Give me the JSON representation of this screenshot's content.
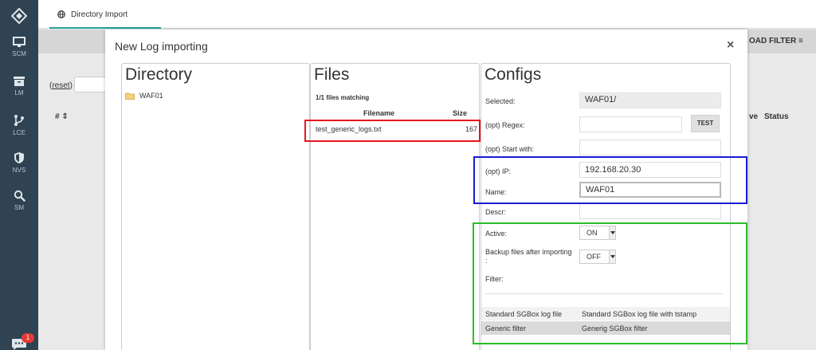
{
  "sidebar": {
    "items": [
      {
        "label": "SCM",
        "icon": "monitor-icon"
      },
      {
        "label": "LM",
        "icon": "archive-icon"
      },
      {
        "label": "LCE",
        "icon": "branch-icon"
      },
      {
        "label": "NVS",
        "icon": "shield-icon"
      },
      {
        "label": "SM",
        "icon": "search-icon"
      }
    ],
    "chat_badge": "1"
  },
  "topbar": {
    "tab_label": "Directory Import"
  },
  "background": {
    "load_filter": "OAD FILTER ≡",
    "reset_prefix": "(",
    "reset_link": "reset",
    "reset_suffix": ")",
    "hash_header": "# ⇕",
    "ive_header": "ve",
    "status_header": "Status"
  },
  "modal": {
    "title": "New Log importing",
    "close": "×"
  },
  "directory": {
    "title": "Directory",
    "item": "WAF01"
  },
  "files": {
    "title": "Files",
    "matching": "1/1 files matching",
    "col_filename": "Filename",
    "col_size": "Size",
    "rows": [
      {
        "name": "test_generic_logs.txt",
        "size": "167"
      }
    ]
  },
  "configs": {
    "title": "Configs",
    "selected_label": "Selected:",
    "selected_value": "WAF01/",
    "regex_label": "(opt) Regex:",
    "regex_value": "",
    "test_button": "TEST",
    "start_label": "(opt) Start with:",
    "start_value": "",
    "ip_label": "(opt) IP:",
    "ip_value": "192.168.20.30",
    "name_label": "Name:",
    "name_value": "WAF01",
    "descr_label": "Descr:",
    "descr_value": "",
    "active_label": "Active:",
    "active_value": "ON",
    "backup_label_line1": "Backup files after importing",
    "backup_label_line2": ":",
    "backup_value": "OFF",
    "filter_label": "Filter:",
    "filters": [
      {
        "name": "Standard SGBox log file",
        "desc": "Standard SGBox log file with tstamp"
      },
      {
        "name": "Generic filter",
        "desc": "Generig SGBox filter"
      }
    ]
  },
  "colors": {
    "sidebar": "#2f4352",
    "accent": "#26a69a",
    "annotation_red": "#e8141c",
    "annotation_blue": "#1a1ad6",
    "annotation_green": "#2bbd2b"
  }
}
